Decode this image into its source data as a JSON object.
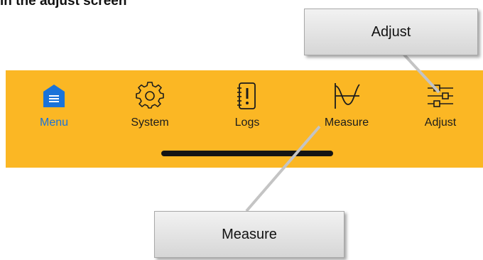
{
  "heading": "in the adjust screen",
  "tabs": [
    {
      "label": "Menu",
      "icon": "home-icon",
      "active": true
    },
    {
      "label": "System",
      "icon": "gear-icon",
      "active": false
    },
    {
      "label": "Logs",
      "icon": "logbook-icon",
      "active": false
    },
    {
      "label": "Measure",
      "icon": "measure-curve-icon",
      "active": false
    },
    {
      "label": "Adjust",
      "icon": "sliders-icon",
      "active": false
    }
  ],
  "callouts": {
    "adjust": "Adjust",
    "measure": "Measure"
  },
  "colors": {
    "tabbar_background": "#fbb724",
    "active_tab": "#1a73d9",
    "callout_fill": "#e4e4e4"
  }
}
